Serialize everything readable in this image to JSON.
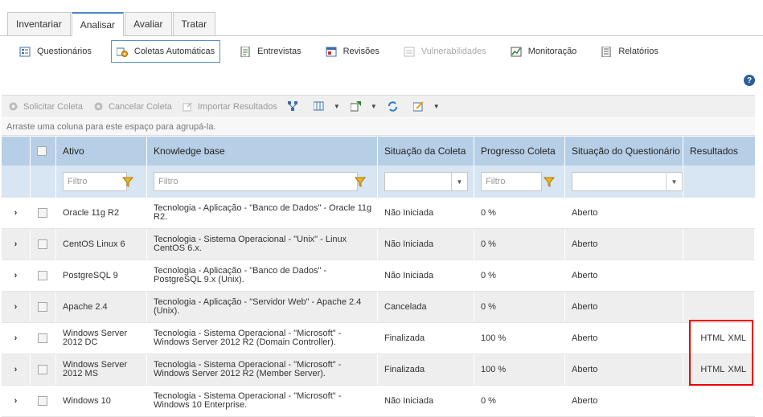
{
  "tabs": [
    {
      "label": "Inventariar",
      "active": false
    },
    {
      "label": "Analisar",
      "active": true
    },
    {
      "label": "Avaliar",
      "active": false
    },
    {
      "label": "Tratar",
      "active": false
    }
  ],
  "subnav": [
    {
      "label": "Questionários",
      "icon": "questionnaire-icon",
      "state": "normal"
    },
    {
      "label": "Coletas Automáticas",
      "icon": "auto-collect-icon",
      "state": "active"
    },
    {
      "label": "Entrevistas",
      "icon": "interview-icon",
      "state": "normal"
    },
    {
      "label": "Revisões",
      "icon": "review-icon",
      "state": "normal"
    },
    {
      "label": "Vulnerabilidades",
      "icon": "vulnerability-icon",
      "state": "disabled"
    },
    {
      "label": "Monitoração",
      "icon": "monitoring-icon",
      "state": "normal"
    },
    {
      "label": "Relatórios",
      "icon": "report-icon",
      "state": "normal"
    }
  ],
  "help": "?",
  "toolbar": {
    "request": "Solicitar Coleta",
    "cancel": "Cancelar Coleta",
    "import": "Importar Resultados"
  },
  "groupbar": "Arraste uma coluna para este espaço para agrupá-la.",
  "columns": [
    "Ativo",
    "Knowledge base",
    "Situação da Coleta",
    "Progresso Coleta",
    "Situação do Questionário",
    "Resultados"
  ],
  "filter_placeholder": "Filtro",
  "rows": [
    {
      "ativo": "Oracle 11g R2",
      "kb": "Tecnologia - Aplicação - \"Banco de Dados\" - Oracle 11g R2.",
      "coleta": "Não Iniciada",
      "progresso": "0 %",
      "questionario": "Aberto",
      "html": "",
      "xml": ""
    },
    {
      "ativo": "CentOS Linux 6",
      "kb": "Tecnologia - Sistema Operacional - \"Unix\" - Linux CentOS 6.x.",
      "coleta": "Não Iniciada",
      "progresso": "0 %",
      "questionario": "Aberto",
      "html": "",
      "xml": ""
    },
    {
      "ativo": "PostgreSQL 9",
      "kb": "Tecnologia - Aplicação - \"Banco de Dados\" - PostgreSQL 9.x (Unix).",
      "coleta": "Não Iniciada",
      "progresso": "0 %",
      "questionario": "Aberto",
      "html": "",
      "xml": ""
    },
    {
      "ativo": "Apache 2.4",
      "kb": "Tecnologia - Aplicação - \"Servidor Web\" - Apache 2.4 (Unix).",
      "coleta": "Cancelada",
      "progresso": "0 %",
      "questionario": "Aberto",
      "html": "",
      "xml": ""
    },
    {
      "ativo": "Windows Server 2012 DC",
      "kb": "Tecnologia - Sistema Operacional - \"Microsoft\" - Windows Server 2012 R2 (Domain Controller).",
      "coleta": "Finalizada",
      "progresso": "100 %",
      "questionario": "Aberto",
      "html": "HTML",
      "xml": "XML"
    },
    {
      "ativo": "Windows Server 2012 MS",
      "kb": "Tecnologia - Sistema Operacional - \"Microsoft\" - Windows Server 2012 R2 (Member Server).",
      "coleta": "Finalizada",
      "progresso": "100 %",
      "questionario": "Aberto",
      "html": "HTML",
      "xml": "XML"
    },
    {
      "ativo": "Windows 10",
      "kb": "Tecnologia - Sistema Operacional - \"Microsoft\" - Windows 10 Enterprise.",
      "coleta": "Não Iniciada",
      "progresso": "0 %",
      "questionario": "Aberto",
      "html": "",
      "xml": ""
    }
  ],
  "colors": {
    "header": "#b7cfe6",
    "filter": "#d8e5f2",
    "highlight": "#e00000",
    "active_tab": "#4a8ac8"
  }
}
